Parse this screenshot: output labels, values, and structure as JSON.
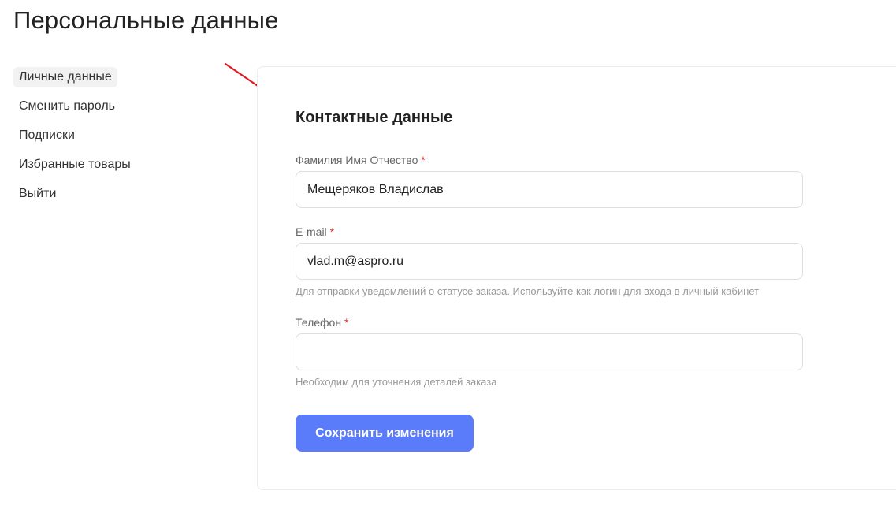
{
  "page": {
    "title": "Персональные данные"
  },
  "sidebar": {
    "items": [
      {
        "label": "Личные данные",
        "active": true
      },
      {
        "label": "Сменить пароль",
        "active": false
      },
      {
        "label": "Подписки",
        "active": false
      },
      {
        "label": "Избранные товары",
        "active": false
      },
      {
        "label": "Выйти",
        "active": false
      }
    ]
  },
  "form": {
    "title": "Контактные данные",
    "required_mark": "*",
    "fio": {
      "label": "Фамилия Имя Отчество",
      "value": "Мещеряков Владислав"
    },
    "email": {
      "label": "E-mail",
      "value": "vlad.m@aspro.ru",
      "hint": "Для отправки уведомлений о статусе заказа. Используйте как логин для входа в личный кабинет"
    },
    "phone": {
      "label": "Телефон",
      "value": "",
      "hint": "Необходим для уточнения деталей заказа"
    },
    "save_label": "Сохранить изменения"
  },
  "colors": {
    "accent": "#5b7cfa",
    "required": "#e03131",
    "annotation_arrow": "#e3181f"
  },
  "icons": {
    "annotation": "red-arrow-icon"
  }
}
